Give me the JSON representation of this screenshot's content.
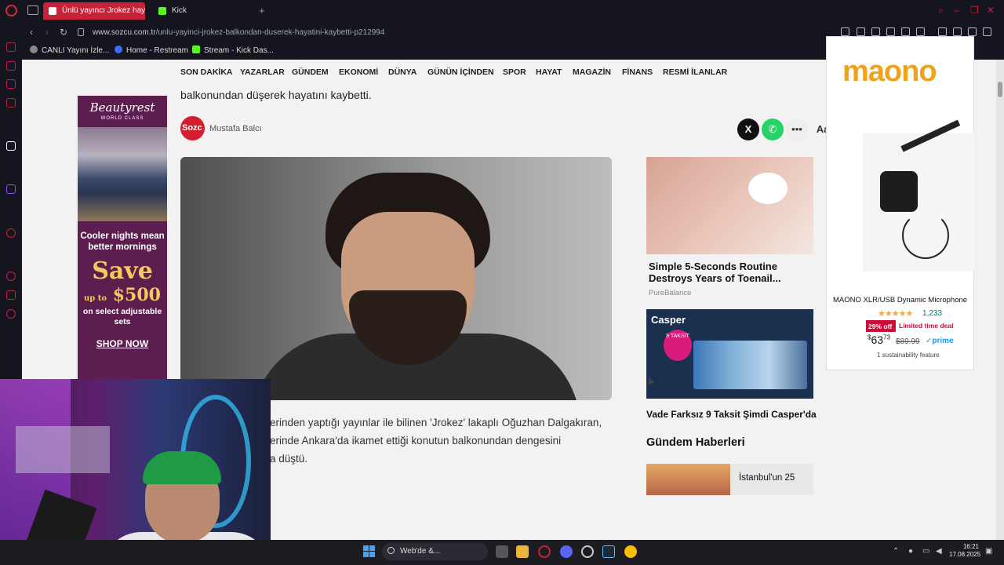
{
  "browser": {
    "tabs": [
      {
        "label": "Ünlü yayıncı Jrokez hayatı",
        "active": true
      },
      {
        "label": "Kick",
        "active": false
      }
    ],
    "url_host": "www.sozcu.com.tr",
    "url_path": "/unlu-yayinci-jrokez-balkondan-duserek-hayatini-kaybetti-p212994",
    "bookmarks": [
      "CANLI Yayını İzle...",
      "Home - Restream",
      "Stream - Kick Das..."
    ],
    "accent": "#c7223a"
  },
  "site": {
    "nav": [
      "SON DAKİKA",
      "YAZARLAR",
      "GÜNDEM",
      "EKONOMİ",
      "DÜNYA",
      "GÜNÜN İÇİNDEN",
      "SPOR",
      "HAYAT",
      "MAGAZİN",
      "FİNANS",
      "RESMİ İLANLAR"
    ],
    "lead_text": "balkonundan düşerek hayatını kaybetti.",
    "author_logo": "Sozc",
    "author_name": "Mustafa Balcı",
    "share": {
      "x": "X",
      "whatsapp": "✆",
      "more": "•••",
      "font": "Aa"
    },
    "body_lines": [
      "erinden yaptığı yayınlar ile bilinen 'Jrokez' lakaplı Oğuzhan Dalgakıran,",
      "erinde Ankara'da ikamet ettiği konutun balkonundan dengesini",
      "a düştü."
    ]
  },
  "ad_left": {
    "brand": "Beautyrest",
    "brand_sub": "WORLD CLASS",
    "headline": "Cooler nights mean better mornings",
    "save": "Save",
    "upto": "up to",
    "amount": "$500",
    "sub": "on select adjustable sets",
    "cta": "SHOP NOW"
  },
  "sidebar_cards": {
    "card1_title": "Simple 5-Seconds Routine Destroys Years of Toenail...",
    "card1_source": "PureBalance",
    "card2_brand": "Casper",
    "card2_badge": "9 TAKSİT",
    "card2_title": "Vade Farksız 9 Taksit Şimdi Casper'da",
    "section_title": "Gündem Haberleri",
    "news_title": "İstanbul'un 25"
  },
  "ad_right": {
    "brand": "maono",
    "product": "MAONO XLR/USB Dynamic Microphone",
    "stars": "★★★★★",
    "rating_count": "1,233",
    "discount": "29% off",
    "deal": "Limited time deal",
    "price_dollars": "63",
    "price_cents": "73",
    "price_currency": "$",
    "price_old": "$89.99",
    "prime": "✓prime",
    "sustain": "1 sustainability feature"
  },
  "taskbar": {
    "search_placeholder": "Web'de &...",
    "time": "16:21",
    "date": "17.08.2025"
  }
}
